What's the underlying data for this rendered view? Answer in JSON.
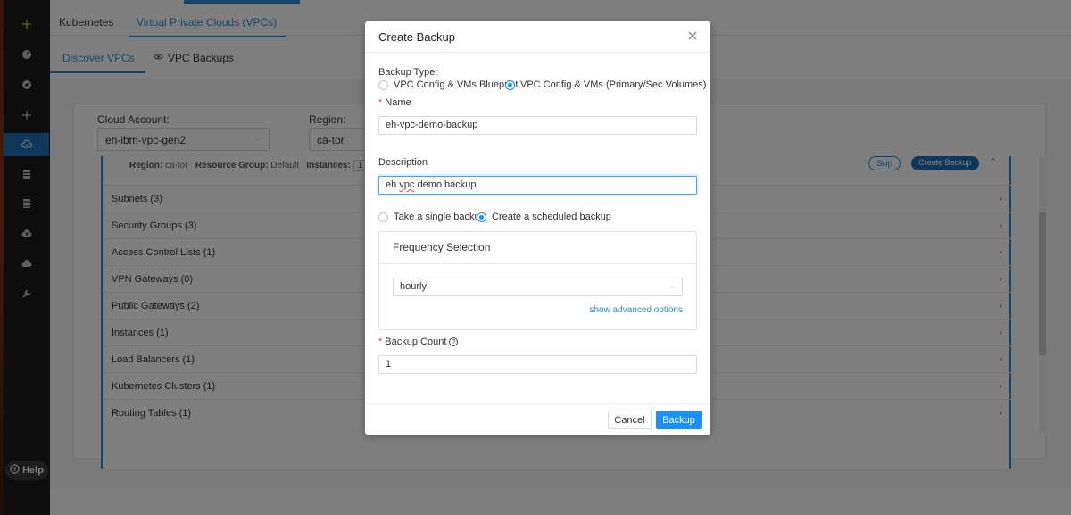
{
  "nav": {
    "help_label": "Help",
    "items": [
      {
        "icon": "plus-icon"
      },
      {
        "icon": "dashboard-icon"
      },
      {
        "icon": "compass-icon"
      },
      {
        "icon": "network-icon"
      },
      {
        "icon": "cloud-network-icon",
        "active": true
      },
      {
        "icon": "server-icon"
      },
      {
        "icon": "storage-icon"
      },
      {
        "icon": "cloud-upload-icon"
      },
      {
        "icon": "cloud-icon"
      },
      {
        "icon": "wrench-icon"
      }
    ]
  },
  "top_tabs": [
    "Kubernetes",
    "Virtual Private Clouds (VPCs)"
  ],
  "sub_tabs": [
    "Discover VPCs",
    "VPC Backups"
  ],
  "filters": {
    "cloud_account_label": "Cloud Account:",
    "cloud_account_value": "eh-ibm-vpc-gen2",
    "region_label": "Region:",
    "region_value": "ca-tor"
  },
  "vpc_meta": {
    "region_label": "Region:",
    "region_value": "ca-tor",
    "rg_label": "Resource Group:",
    "rg_value": "Default",
    "instances_label": "Instances:",
    "instances_value": "1",
    "skip_label": "Skip",
    "create_backup_label": "Create Backup"
  },
  "resources": [
    "Subnets (3)",
    "Security Groups (3)",
    "Access Control Lists (1)",
    "VPN Gateways (0)",
    "Public Gateways (2)",
    "Instances (1)",
    "Load Balancers (1)",
    "Kubernetes Clusters (1)",
    "Routing Tables (1)"
  ],
  "modal": {
    "title": "Create Backup",
    "backup_type_label": "Backup Type:",
    "backup_type_options": [
      "VPC Config & VMs Blueprint.",
      "VPC Config & VMs (Primary/Sec Volumes)"
    ],
    "backup_type_selected": 1,
    "name_label": "Name",
    "name_value": "eh-vpc-demo-backup",
    "description_label": "Description",
    "description_value_1": "eh ",
    "description_value_2": "vpc",
    "description_value_3": " demo backup",
    "mode_options": [
      "Take a single backup",
      "Create a scheduled backup"
    ],
    "mode_selected": 1,
    "frequency_title": "Frequency Selection",
    "frequency_value": "hourly",
    "advanced_link": "show advanced options",
    "backup_count_label": "Backup Count",
    "backup_count_value": "1",
    "cancel_label": "Cancel",
    "submit_label": "Backup"
  }
}
